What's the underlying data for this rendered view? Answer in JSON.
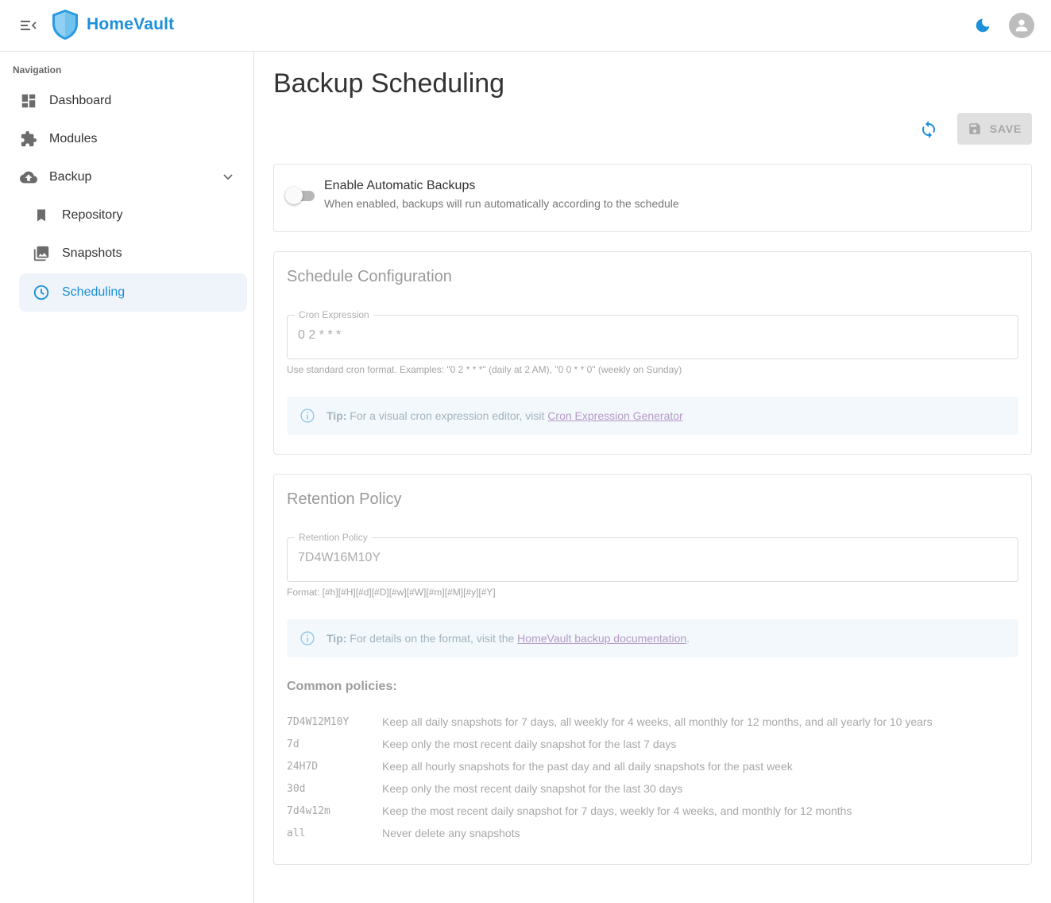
{
  "app": {
    "title": "HomeVault",
    "accent_color": "#1b8fd8",
    "icons": {
      "menu": "menu-collapse-icon",
      "logo": "shield-logo",
      "theme": "moon-icon",
      "avatar": "person-icon"
    }
  },
  "sidebar": {
    "heading": "Navigation",
    "items": [
      {
        "label": "Dashboard",
        "icon": "dashboard-icon",
        "active": false
      },
      {
        "label": "Modules",
        "icon": "puzzle-icon",
        "active": false
      },
      {
        "label": "Backup",
        "icon": "cloud-upload-icon",
        "expanded": true,
        "active": false
      },
      {
        "label": "Repository",
        "icon": "bookmark-icon",
        "active": false
      },
      {
        "label": "Snapshots",
        "icon": "photo-library-icon",
        "active": false
      },
      {
        "label": "Scheduling",
        "icon": "clock-icon",
        "active": true
      }
    ]
  },
  "page": {
    "title": "Backup Scheduling",
    "refresh_icon": "sync-icon",
    "save_label": "SAVE",
    "save_disabled": true
  },
  "enable": {
    "title": "Enable Automatic Backups",
    "description": "When enabled, backups will run automatically according to the schedule",
    "enabled": false
  },
  "schedule": {
    "title": "Schedule Configuration",
    "cron_label": "Cron Expression",
    "cron_value": "0 2 * * *",
    "helper": "Use standard cron format. Examples: \"0 2 * * *\" (daily at 2 AM), \"0 0 * * 0\" (weekly on Sunday)",
    "tip_label": "Tip:",
    "tip_text": "For a visual cron expression editor, visit",
    "tip_link": "Cron Expression Generator"
  },
  "retention": {
    "title": "Retention Policy",
    "field_label": "Retention Policy",
    "field_value": "7D4W16M10Y",
    "helper": "Format: [#h][#H][#d][#D][#w][#W][#m][#M][#y][#Y]",
    "tip_label": "Tip:",
    "tip_text": "For details on the format, visit the",
    "tip_link": "HomeVault backup documentation",
    "tip_suffix": ".",
    "common_heading": "Common policies:",
    "policies": [
      {
        "code": "7D4W12M10Y",
        "description": "Keep all daily snapshots for 7 days, all weekly for 4 weeks, all monthly for 12 months, and all yearly for 10 years"
      },
      {
        "code": "7d",
        "description": "Keep only the most recent daily snapshot for the last 7 days"
      },
      {
        "code": "24H7D",
        "description": "Keep all hourly snapshots for the past day and all daily snapshots for the past week"
      },
      {
        "code": "30d",
        "description": "Keep only the most recent daily snapshot for the last 30 days"
      },
      {
        "code": "7d4w12m",
        "description": "Keep the most recent daily snapshot for 7 days, weekly for 4 weeks, and monthly for 12 months"
      },
      {
        "code": "all",
        "description": "Never delete any snapshots"
      }
    ]
  }
}
